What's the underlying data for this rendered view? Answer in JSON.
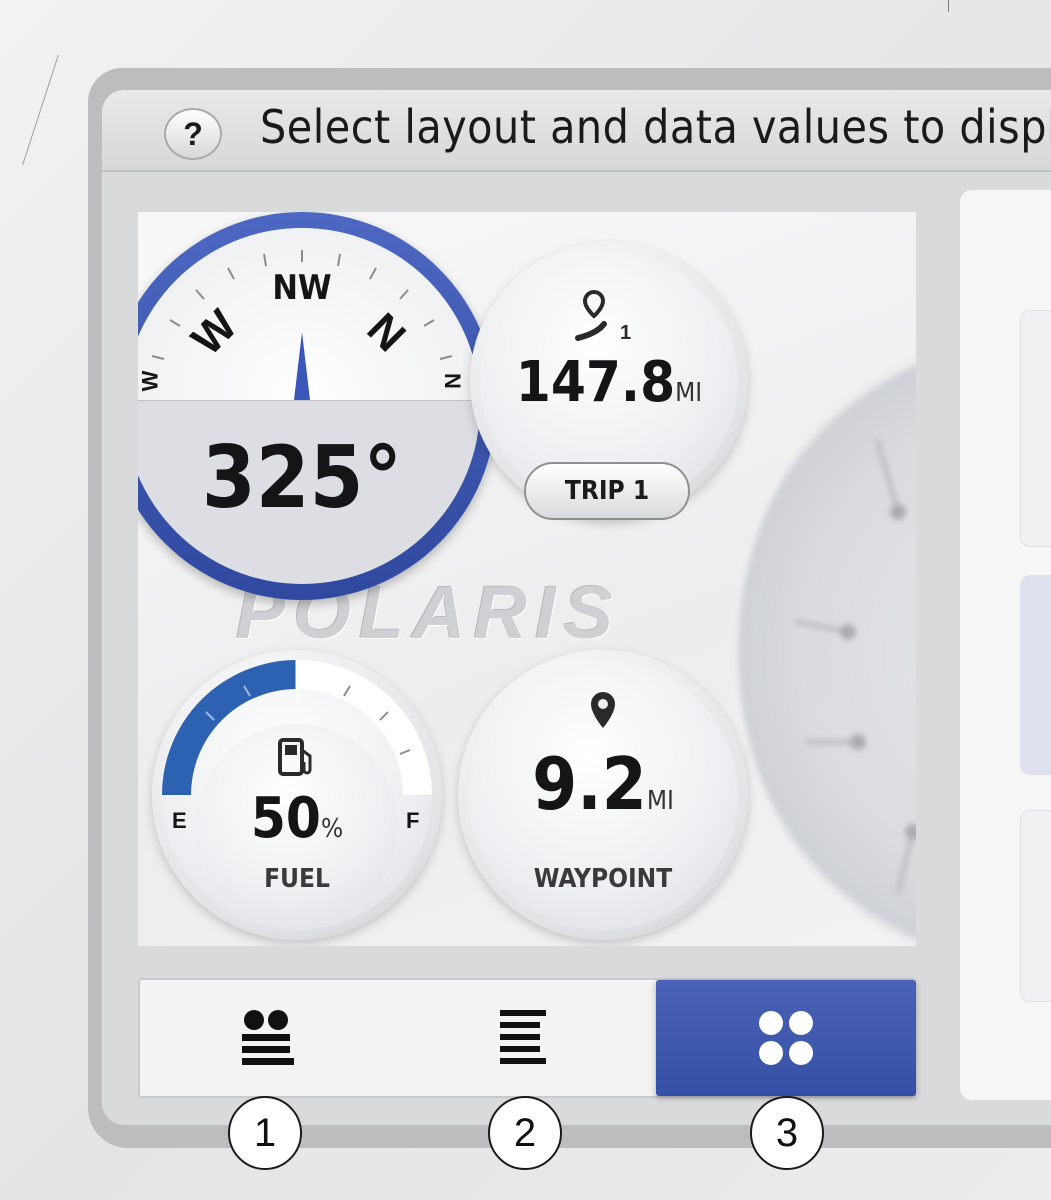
{
  "header": {
    "help_glyph": "?",
    "title": "Select layout and data values to display"
  },
  "preview": {
    "brand": "POLARIS",
    "compass": {
      "north_label": "NW",
      "left_mark": "W",
      "right_mark": "N",
      "far_left_mark": "W",
      "far_right_mark": "N",
      "heading": "325°"
    },
    "trip": {
      "icon": "route-waypoint-icon",
      "index": "1",
      "value": "147.8",
      "unit": "MI",
      "button_label": "TRIP 1"
    },
    "fuel": {
      "icon": "fuel-pump-icon",
      "value": "50",
      "unit": "%",
      "empty_label": "E",
      "full_label": "F",
      "label": "FUEL",
      "level_percent": 50
    },
    "waypoint": {
      "icon": "map-pin-icon",
      "value": "9.2",
      "unit": "MI",
      "label": "WAYPOINT"
    }
  },
  "layouts": {
    "options": [
      {
        "icon": "layout-two-gauges-icon"
      },
      {
        "icon": "layout-list-icon"
      },
      {
        "icon": "layout-four-gauges-icon",
        "selected": true
      }
    ]
  },
  "callouts": [
    "1",
    "2",
    "3"
  ],
  "colors": {
    "accent": "#3550a6",
    "fuel_fill": "#2d62b3"
  }
}
